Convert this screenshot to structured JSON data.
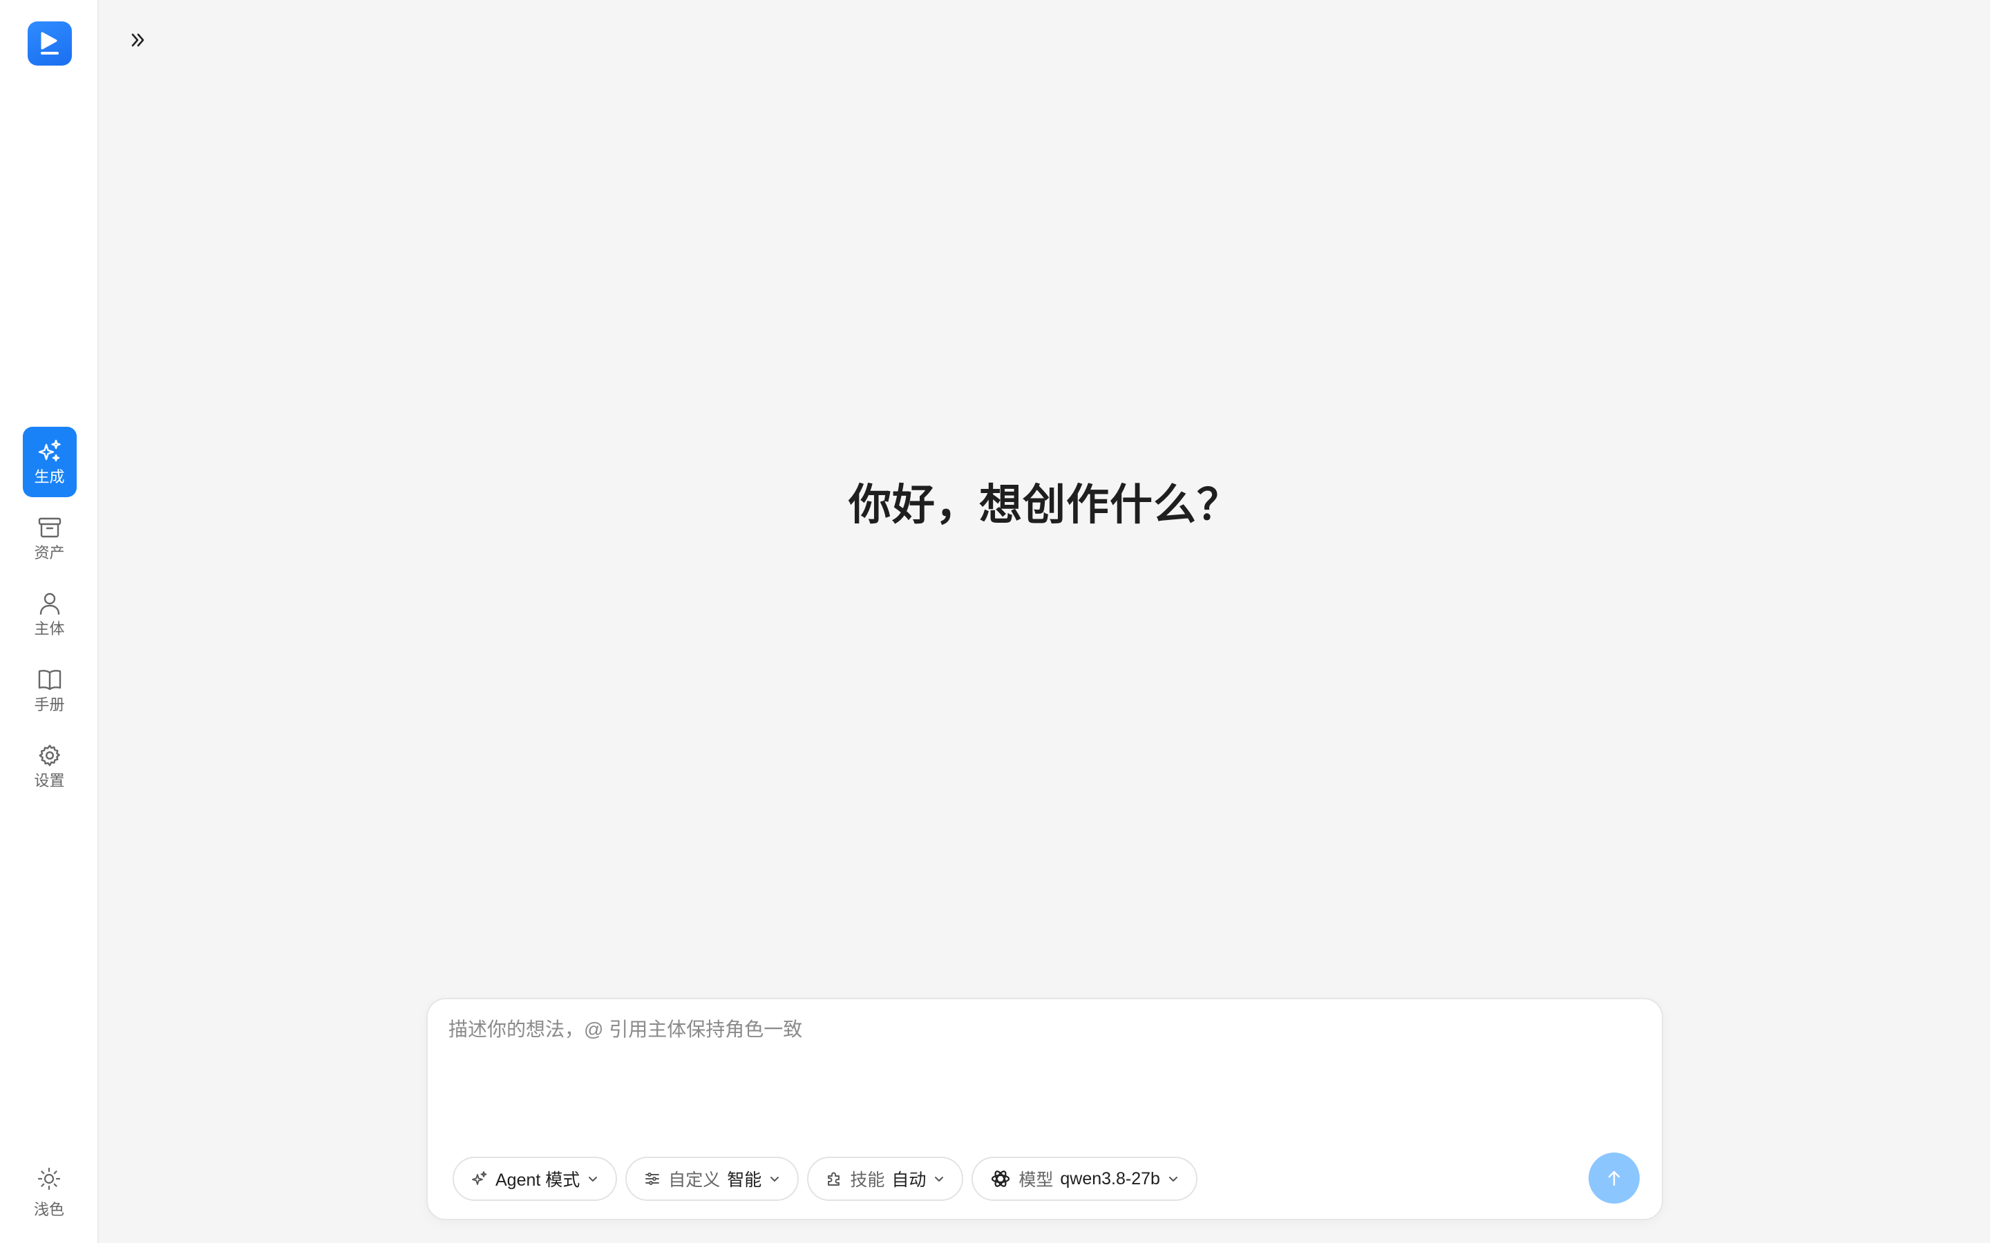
{
  "sidebar": {
    "logo_icon": "play-logo-icon",
    "items": [
      {
        "label": "生成",
        "icon": "sparkle-icon",
        "active": true
      },
      {
        "label": "资产",
        "icon": "archive-box-icon",
        "active": false
      },
      {
        "label": "主体",
        "icon": "person-icon",
        "active": false
      },
      {
        "label": "手册",
        "icon": "book-icon",
        "active": false
      },
      {
        "label": "设置",
        "icon": "gear-icon",
        "active": false
      }
    ],
    "theme_label": "浅色"
  },
  "main": {
    "greeting": "你好，想创作什么？"
  },
  "composer": {
    "placeholder": "描述你的想法，@ 引用主体保持角色一致",
    "value": "",
    "mode": {
      "label": "Agent 模式"
    },
    "custom": {
      "label": "自定义",
      "value": "智能"
    },
    "skill": {
      "label": "技能",
      "value": "自动"
    },
    "model": {
      "label": "模型",
      "value": "qwen3.8-27b"
    }
  },
  "colors": {
    "accent": "#1a82f7",
    "send_button": "#8cc6ff",
    "background": "#f5f5f5"
  }
}
